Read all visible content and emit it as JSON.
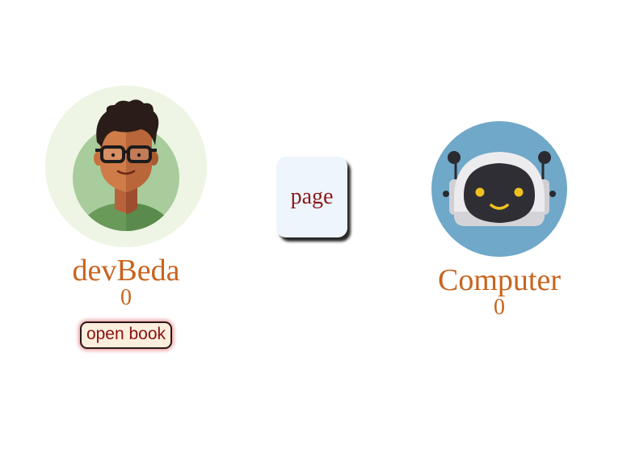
{
  "players": {
    "user": {
      "name": "devBeda",
      "score": "0",
      "avatar_icon": "man-with-glasses-avatar-icon"
    },
    "computer": {
      "name": "Computer",
      "score": "0",
      "avatar_icon": "robot-avatar-icon"
    }
  },
  "controls": {
    "open_book_label": "open book",
    "page_label": "page"
  },
  "colors": {
    "name_text": "#c8641e",
    "page_text": "#8b1a1a",
    "button_text": "#8b1010",
    "button_bg": "#fbeedd",
    "page_bg": "#eef5fc",
    "user_avatar_bg": "#eef5e4",
    "robot_avatar_bg": "#6fa8c8"
  }
}
